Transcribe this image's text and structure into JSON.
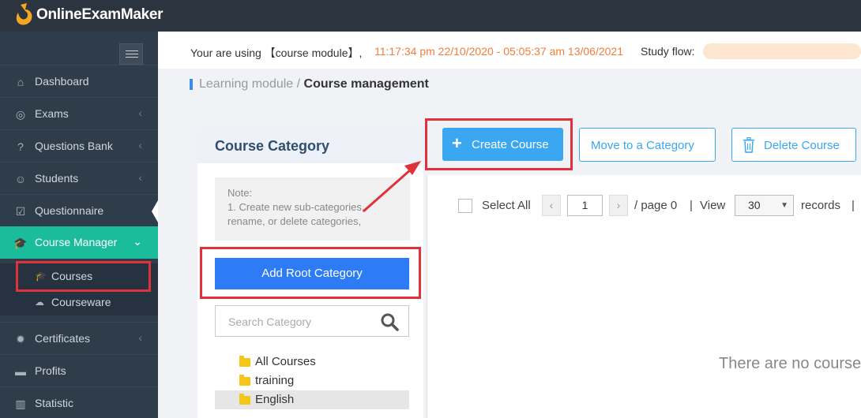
{
  "app": {
    "name": "OnlineExamMaker"
  },
  "sidebar": {
    "items": [
      {
        "label": "Dashboard",
        "icon": "home-icon"
      },
      {
        "label": "Exams",
        "icon": "check-circle-icon"
      },
      {
        "label": "Questions Bank",
        "icon": "question-circle-icon"
      },
      {
        "label": "Students",
        "icon": "users-icon"
      },
      {
        "label": "Questionnaire",
        "icon": "checkbox-icon"
      },
      {
        "label": "Course Manager",
        "icon": "graduation-cap-icon"
      },
      {
        "label": "Certificates",
        "icon": "badge-icon"
      },
      {
        "label": "Profits",
        "icon": "card-icon"
      },
      {
        "label": "Statistic",
        "icon": "bar-chart-icon"
      }
    ],
    "subitems": [
      {
        "label": "Courses",
        "icon": "graduation-cap-icon"
      },
      {
        "label": "Courseware",
        "icon": "cloud-upload-icon"
      }
    ]
  },
  "infobar": {
    "prefix": "Your are using 【course module】,",
    "time_range": "11:17:34 pm 22/10/2020 - 05:05:37 am 13/06/2021",
    "flow_label": "Study flow:"
  },
  "breadcrumb": {
    "parent": "Learning module /",
    "current": "Course management"
  },
  "category": {
    "title": "Course Category",
    "note_title": "Note:",
    "note_text": "1. Create new sub-categories, rename, or delete categories,",
    "add_root_label": "Add Root Category",
    "search_placeholder": "Search Category",
    "tree": [
      "All Courses",
      "training",
      "English"
    ]
  },
  "toolbar": {
    "create_label": "Create Course",
    "move_label": "Move to a Category",
    "delete_label": "Delete Course"
  },
  "pagination": {
    "select_all": "Select All",
    "prev": "‹",
    "next": "›",
    "page": "1",
    "page_suffix": "/ page 0",
    "sep1": "|",
    "view_label": "View",
    "per_page": "30",
    "records_label": "records",
    "sep2": "|"
  },
  "empty_message": "There are no courses",
  "colors": {
    "accent": "#1abc9c",
    "primary": "#2d7cf6",
    "highlight_box": "#e0323a",
    "time": "#f07e3a"
  }
}
